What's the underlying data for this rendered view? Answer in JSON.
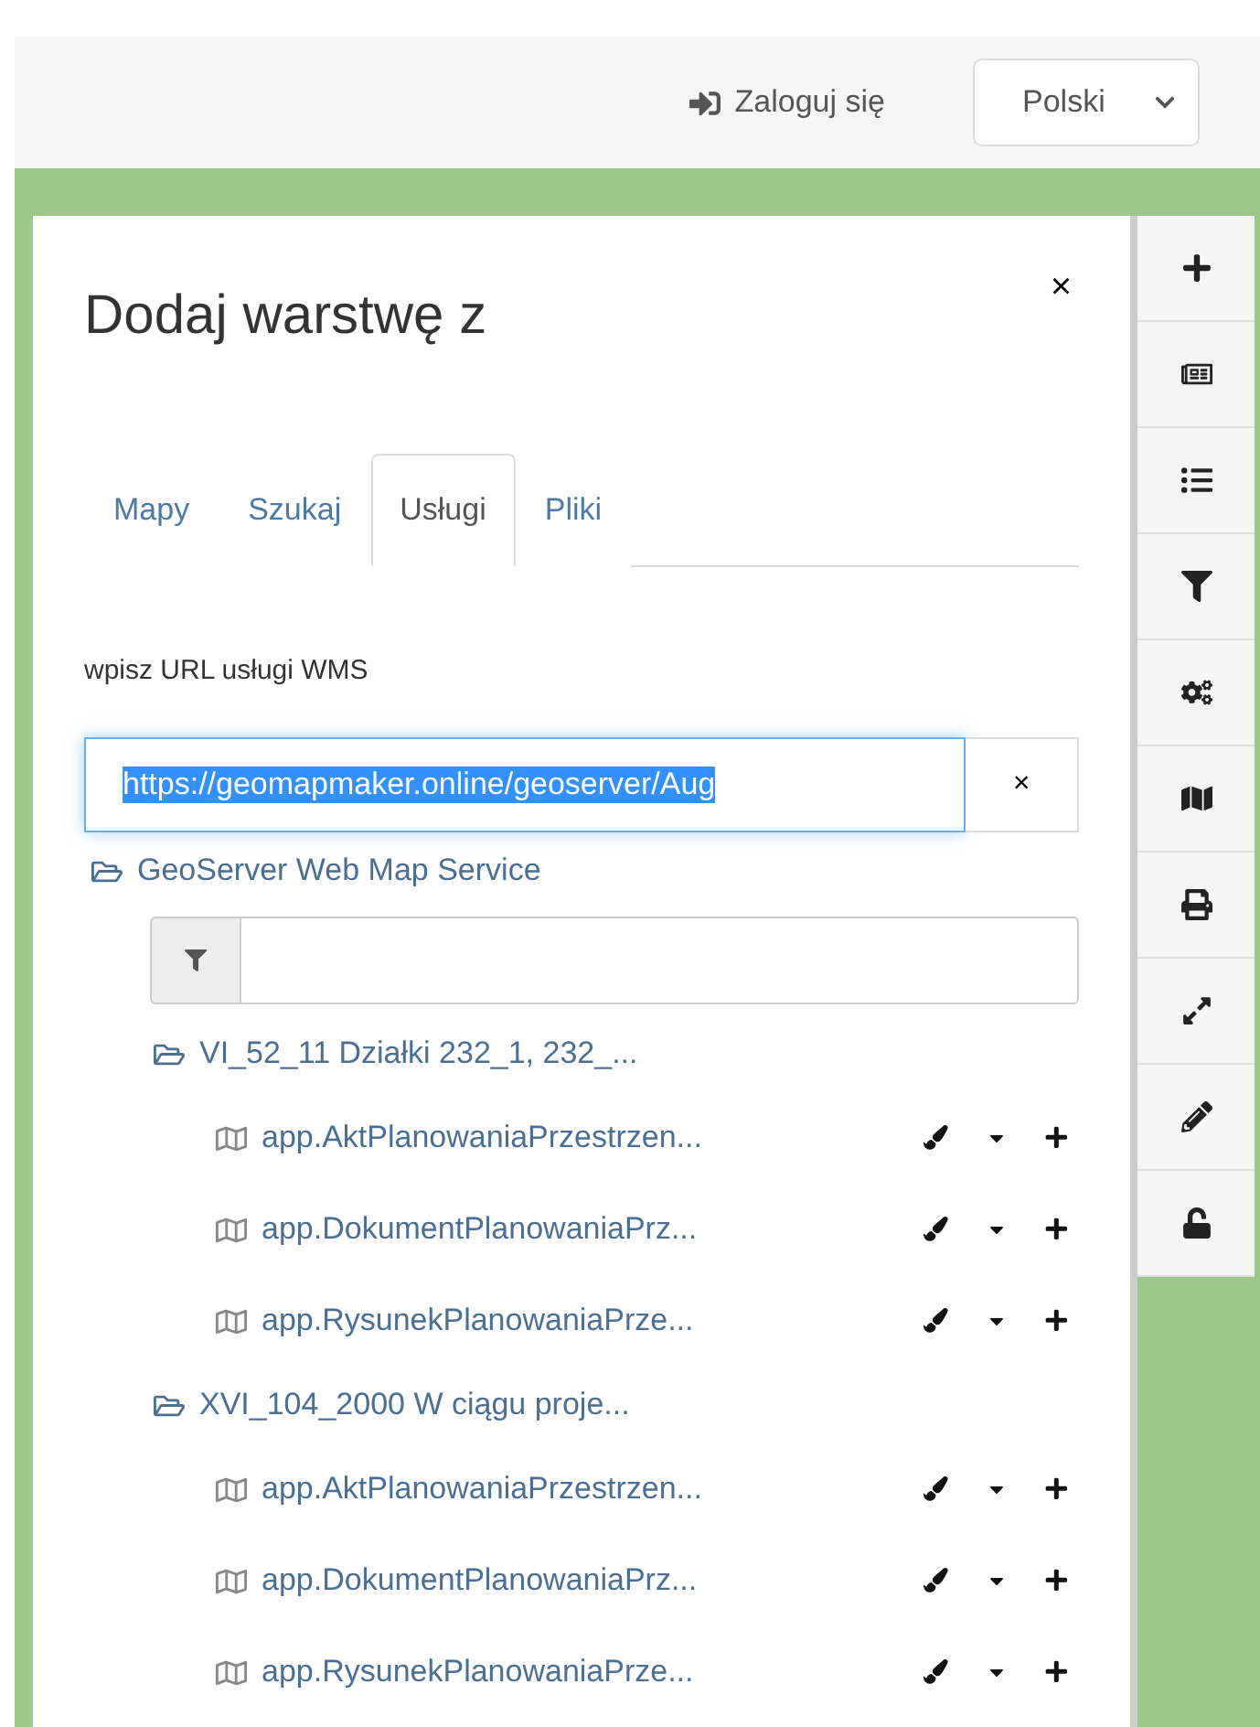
{
  "header": {
    "login": "Zaloguj się",
    "language": "Polski"
  },
  "panel": {
    "title": "Dodaj warstwę z",
    "close": "×",
    "tabs": [
      {
        "label": "Mapy",
        "selected": false
      },
      {
        "label": "Szukaj",
        "selected": false
      },
      {
        "label": "Usługi",
        "selected": true
      },
      {
        "label": "Pliki",
        "selected": false
      }
    ],
    "url_label": "wpisz URL usługi WMS",
    "url_field": {
      "value": "https://geomapmaker.online/geoserver/Aug",
      "selected_text": true
    },
    "clear": "×",
    "tree": [
      {
        "label": "GeoServer Web Map Service",
        "expanded": true,
        "filter": {
          "shown": true
        },
        "children": [
          {
            "label": "VI_52_11 Działki 232_1, 232_...",
            "expanded": true,
            "children": [
              {
                "label": "app.AktPlanowaniaPrzestrzen..."
              },
              {
                "label": "app.DokumentPlanowaniaPrz..."
              },
              {
                "label": "app.RysunekPlanowaniaPrze..."
              }
            ]
          },
          {
            "label": "XVI_104_2000 W ciągu proje...",
            "expanded": true,
            "children": [
              {
                "label": "app.AktPlanowaniaPrzestrzen..."
              },
              {
                "label": "app.DokumentPlanowaniaPrz..."
              },
              {
                "label": "app.RysunekPlanowaniaPrze..."
              }
            ]
          }
        ]
      }
    ]
  },
  "toolbar": [
    {
      "kind": "plus"
    },
    {
      "kind": "legend"
    },
    {
      "kind": "list"
    },
    {
      "kind": "filter"
    },
    {
      "kind": "cogs"
    },
    {
      "kind": "map"
    },
    {
      "kind": "print"
    },
    {
      "kind": "expand"
    },
    {
      "kind": "pencil"
    },
    {
      "kind": "unlock"
    }
  ]
}
